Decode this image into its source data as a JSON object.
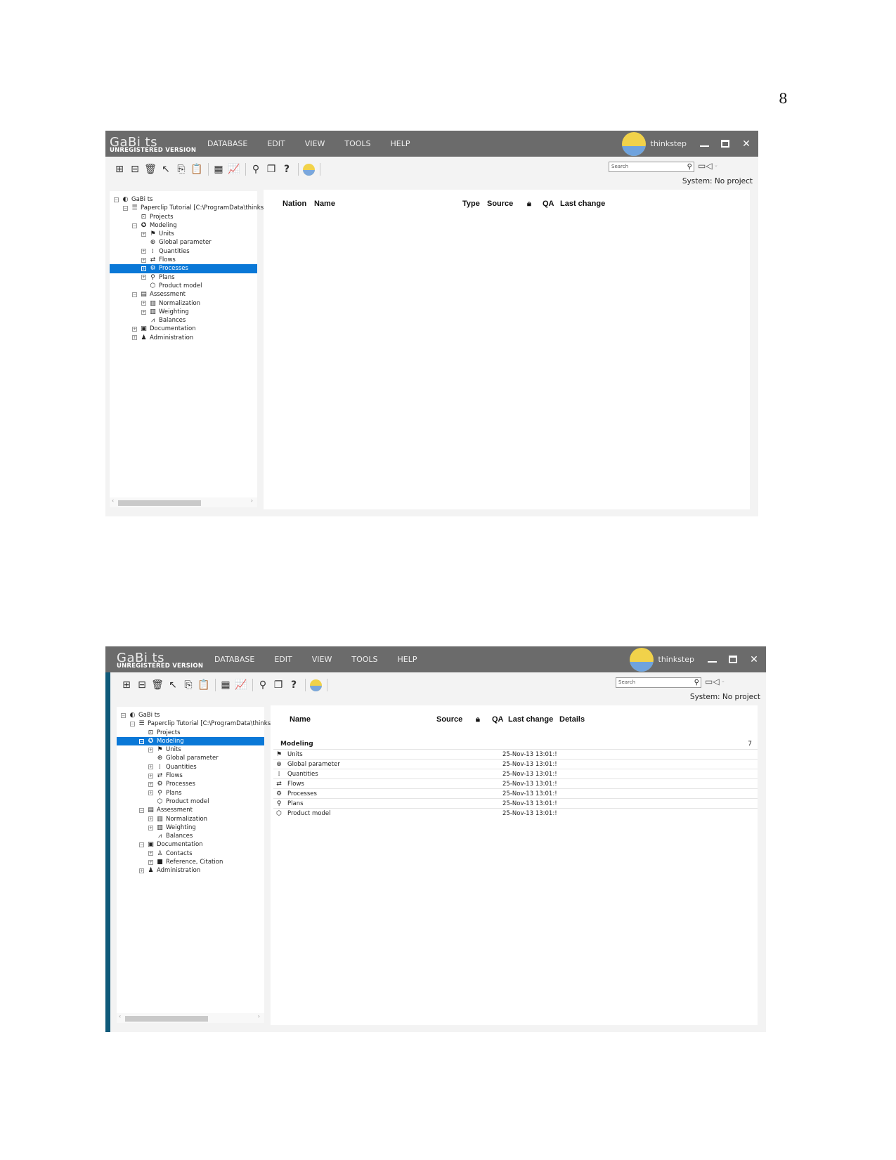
{
  "page_number": "8",
  "app": {
    "brand": "GaBi ts",
    "unregistered": "UNREGISTERED VERSION",
    "menu": [
      "DATABASE",
      "EDIT",
      "VIEW",
      "TOOLS",
      "HELP"
    ],
    "company": "thinkstep",
    "search_placeholder": "Search",
    "system_status": "System: No project",
    "colors": {
      "titlebar": "#6b6b6b",
      "selection": "#0a78d7",
      "sidebar_accent": "#0f5a7a",
      "logo_yellow": "#f1d24a",
      "logo_blue": "#6fa3de"
    },
    "toolbar_icons": [
      "new-icon",
      "open-icon",
      "delete-icon",
      "pointer-icon",
      "copy-icon",
      "paste-icon",
      "balance-sheet-icon",
      "chart-icon",
      "search-icon",
      "window-icon",
      "help-icon",
      "thinkstep-icon"
    ]
  },
  "window1": {
    "tree": [
      {
        "label": "GaBi ts",
        "level": 0,
        "exp": "minus",
        "icon": "gabi-icon"
      },
      {
        "label": "Paperclip Tutorial [C:\\ProgramData\\thinks",
        "level": 1,
        "exp": "minus",
        "icon": "database-icon"
      },
      {
        "label": "Projects",
        "level": 2,
        "exp": "none",
        "icon": "projects-icon"
      },
      {
        "label": "Modeling",
        "level": 2,
        "exp": "minus",
        "icon": "modeling-icon"
      },
      {
        "label": "Units",
        "level": 3,
        "exp": "plus",
        "icon": "units-icon"
      },
      {
        "label": "Global parameter",
        "level": 3,
        "exp": "none",
        "icon": "globe-icon"
      },
      {
        "label": "Quantities",
        "level": 3,
        "exp": "plus",
        "icon": "quantities-icon"
      },
      {
        "label": "Flows",
        "level": 3,
        "exp": "plus",
        "icon": "flows-icon"
      },
      {
        "label": "Processes",
        "level": 3,
        "exp": "plus",
        "icon": "processes-icon",
        "selected": true
      },
      {
        "label": "Plans",
        "level": 3,
        "exp": "plus",
        "icon": "plans-icon"
      },
      {
        "label": "Product model",
        "level": 3,
        "exp": "none",
        "icon": "product-model-icon"
      },
      {
        "label": "Assessment",
        "level": 2,
        "exp": "minus",
        "icon": "assessment-icon"
      },
      {
        "label": "Normalization",
        "level": 3,
        "exp": "plus",
        "icon": "normalization-icon"
      },
      {
        "label": "Weighting",
        "level": 3,
        "exp": "plus",
        "icon": "weighting-icon"
      },
      {
        "label": "Balances",
        "level": 3,
        "exp": "none",
        "icon": "balances-icon"
      },
      {
        "label": "Documentation",
        "level": 2,
        "exp": "plus",
        "icon": "documentation-icon"
      },
      {
        "label": "Administration",
        "level": 2,
        "exp": "plus",
        "icon": "administration-icon"
      }
    ],
    "columns": [
      "Nation",
      "Name",
      "Type",
      "Source",
      "lock",
      "QA",
      "Last change"
    ]
  },
  "window2": {
    "tree": [
      {
        "label": "GaBi ts",
        "level": 0,
        "exp": "minus",
        "icon": "gabi-icon"
      },
      {
        "label": "Paperclip Tutorial [C:\\ProgramData\\thinks",
        "level": 1,
        "exp": "minus",
        "icon": "database-icon"
      },
      {
        "label": "Projects",
        "level": 2,
        "exp": "none",
        "icon": "projects-icon"
      },
      {
        "label": "Modeling",
        "level": 2,
        "exp": "minus",
        "icon": "modeling-icon",
        "selected": true
      },
      {
        "label": "Units",
        "level": 3,
        "exp": "plus",
        "icon": "units-icon"
      },
      {
        "label": "Global parameter",
        "level": 3,
        "exp": "none",
        "icon": "globe-icon"
      },
      {
        "label": "Quantities",
        "level": 3,
        "exp": "plus",
        "icon": "quantities-icon"
      },
      {
        "label": "Flows",
        "level": 3,
        "exp": "plus",
        "icon": "flows-icon"
      },
      {
        "label": "Processes",
        "level": 3,
        "exp": "plus",
        "icon": "processes-icon"
      },
      {
        "label": "Plans",
        "level": 3,
        "exp": "plus",
        "icon": "plans-icon"
      },
      {
        "label": "Product model",
        "level": 3,
        "exp": "none",
        "icon": "product-model-icon"
      },
      {
        "label": "Assessment",
        "level": 2,
        "exp": "minus",
        "icon": "assessment-icon"
      },
      {
        "label": "Normalization",
        "level": 3,
        "exp": "plus",
        "icon": "normalization-icon"
      },
      {
        "label": "Weighting",
        "level": 3,
        "exp": "plus",
        "icon": "weighting-icon"
      },
      {
        "label": "Balances",
        "level": 3,
        "exp": "none",
        "icon": "balances-icon"
      },
      {
        "label": "Documentation",
        "level": 2,
        "exp": "minus",
        "icon": "documentation-icon"
      },
      {
        "label": "Contacts",
        "level": 3,
        "exp": "plus",
        "icon": "contacts-icon"
      },
      {
        "label": "Reference, Citation",
        "level": 3,
        "exp": "plus",
        "icon": "reference-icon"
      },
      {
        "label": "Administration",
        "level": 2,
        "exp": "plus",
        "icon": "administration-icon"
      }
    ],
    "columns": [
      "Name",
      "Source",
      "lock",
      "QA",
      "Last change",
      "Details"
    ],
    "group": {
      "label": "Modeling",
      "count": "7"
    },
    "rows": [
      {
        "icon": "units-icon",
        "name": "Units",
        "last_change": "25-Nov-13 13:01:!"
      },
      {
        "icon": "globe-icon",
        "name": "Global parameter",
        "last_change": "25-Nov-13 13:01:!"
      },
      {
        "icon": "quantities-icon",
        "name": "Quantities",
        "last_change": "25-Nov-13 13:01:!"
      },
      {
        "icon": "flows-icon",
        "name": "Flows",
        "last_change": "25-Nov-13 13:01:!"
      },
      {
        "icon": "processes-icon",
        "name": "Processes",
        "last_change": "25-Nov-13 13:01:!"
      },
      {
        "icon": "plans-icon",
        "name": "Plans",
        "last_change": "25-Nov-13 13:01:!"
      },
      {
        "icon": "product-model-icon",
        "name": "Product model",
        "last_change": "25-Nov-13 13:01:!"
      }
    ]
  }
}
